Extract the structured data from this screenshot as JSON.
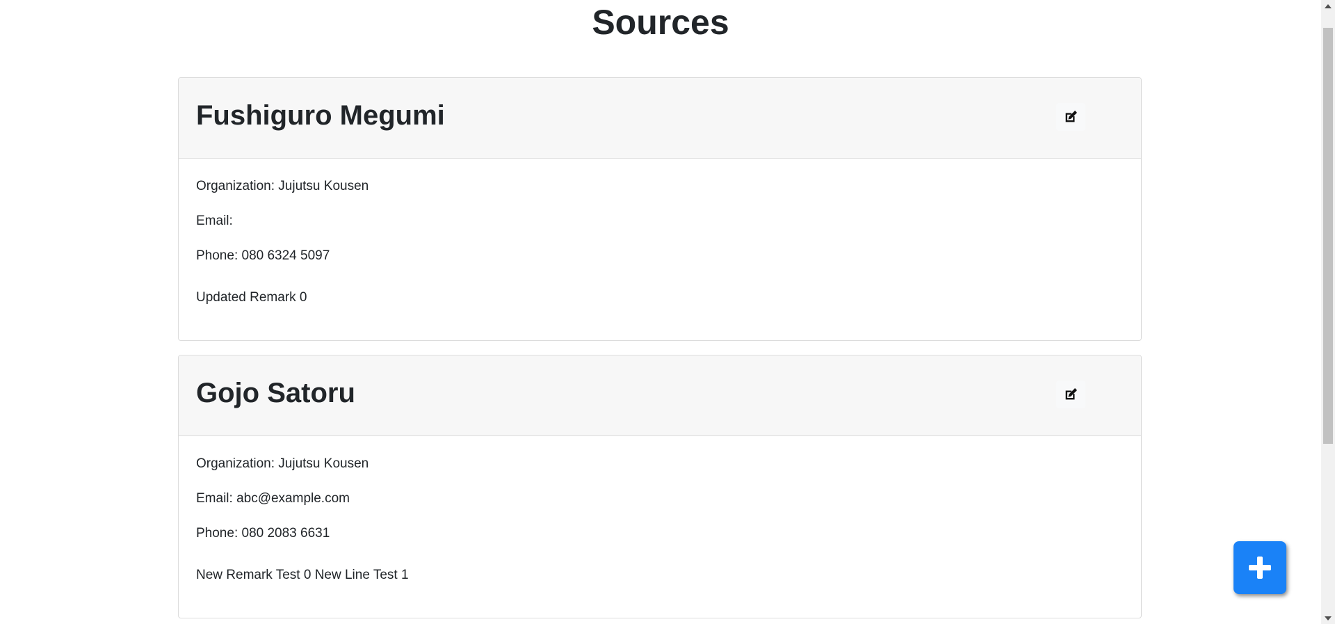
{
  "page": {
    "title": "Sources"
  },
  "sources": [
    {
      "name": "Fushiguro Megumi",
      "organization": "Organization: Jujutsu Kousen",
      "email": "Email:",
      "phone": "Phone: 080 6324 5097",
      "remark": "Updated Remark 0"
    },
    {
      "name": "Gojo Satoru",
      "organization": "Organization: Jujutsu Kousen",
      "email": "Email: abc@example.com",
      "phone": "Phone: 080 2083 6631",
      "remark": "New Remark Test 0 New Line Test 1"
    }
  ],
  "icons": {
    "edit": "edit-icon",
    "add": "plus-icon"
  },
  "colors": {
    "accent": "#1a82f7",
    "card_header_bg": "#f7f7f7",
    "border": "#dcdcdc",
    "text": "#212529"
  }
}
